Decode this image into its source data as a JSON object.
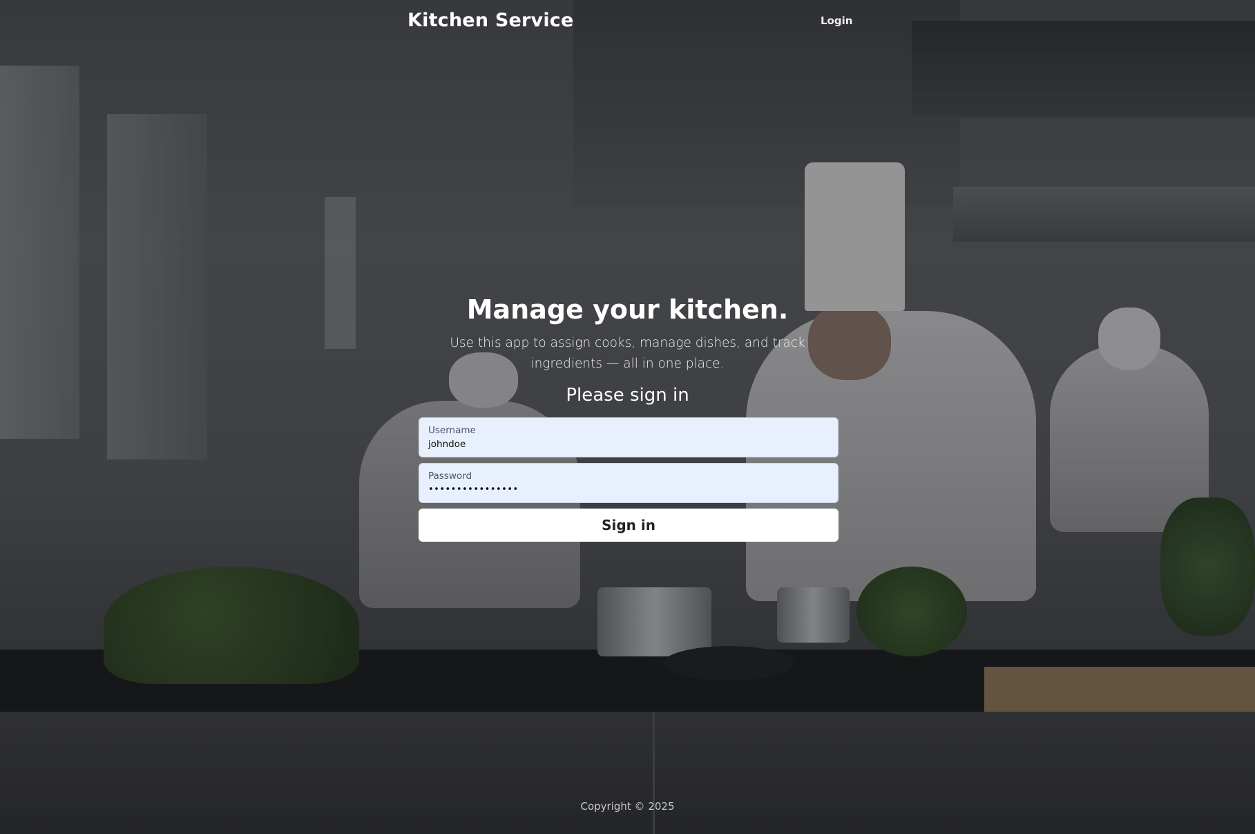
{
  "header": {
    "brand": "Kitchen Service",
    "login_link": "Login"
  },
  "hero": {
    "title": "Manage your kitchen.",
    "description": "Use this app to assign cooks, manage dishes, and track ingredients — all in one place.",
    "signin_title": "Please sign in"
  },
  "form": {
    "username_label": "Username",
    "username_value": "johndoe",
    "password_label": "Password",
    "password_value": "••••••••••••••••",
    "submit_label": "Sign in"
  },
  "footer": {
    "copyright": "Copyright © 2025"
  },
  "colors": {
    "input_bg": "#e8f0fe",
    "button_bg": "#ffffff",
    "text": "#ffffff"
  }
}
